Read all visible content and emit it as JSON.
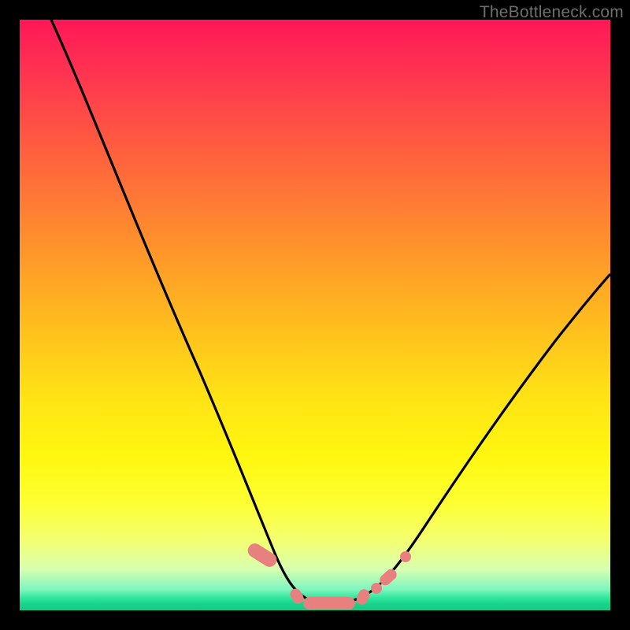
{
  "watermark": "TheBottleneck.com",
  "chart_data": {
    "type": "line",
    "title": "",
    "xlabel": "",
    "ylabel": "",
    "xlim": [
      0,
      100
    ],
    "ylim": [
      0,
      100
    ],
    "grid": false,
    "series": [
      {
        "name": "bottleneck-curve",
        "x": [
          5,
          10,
          15,
          20,
          25,
          30,
          35,
          40,
          45,
          47,
          50,
          53,
          56,
          58,
          60,
          63,
          67,
          72,
          78,
          85,
          92,
          100
        ],
        "y": [
          100,
          87,
          74,
          61,
          48,
          36,
          25,
          15,
          7,
          4,
          2,
          1,
          1,
          1,
          2,
          4,
          8,
          14,
          22,
          32,
          43,
          55
        ]
      }
    ],
    "markers": [
      {
        "shape": "round-rect",
        "x0": 39.5,
        "y0": 6.8,
        "x1": 42.0,
        "y1": 10.8,
        "rot": -58
      },
      {
        "shape": "round-rect",
        "x0": 46.0,
        "y0": 1.6,
        "x1": 48.3,
        "y1": 3.3,
        "rot": -30
      },
      {
        "shape": "round-rect",
        "x0": 48.0,
        "y0": 0.6,
        "x1": 56.5,
        "y1": 2.1,
        "rot": 0
      },
      {
        "shape": "round-rect",
        "x0": 57.0,
        "y0": 1.2,
        "x1": 59.0,
        "y1": 3.1,
        "rot": 24
      },
      {
        "shape": "circle",
        "cx": 60.4,
        "cy": 3.7,
        "r": 0.9
      },
      {
        "shape": "round-rect",
        "x0": 61.3,
        "y0": 4.4,
        "x1": 63.2,
        "y1": 7.0,
        "rot": 48
      },
      {
        "shape": "circle",
        "cx": 65.0,
        "cy": 9.0,
        "r": 0.9
      }
    ],
    "colors": {
      "curve": "#000000",
      "marker_fill": "#e98080",
      "marker_stroke": "#e98080"
    }
  }
}
